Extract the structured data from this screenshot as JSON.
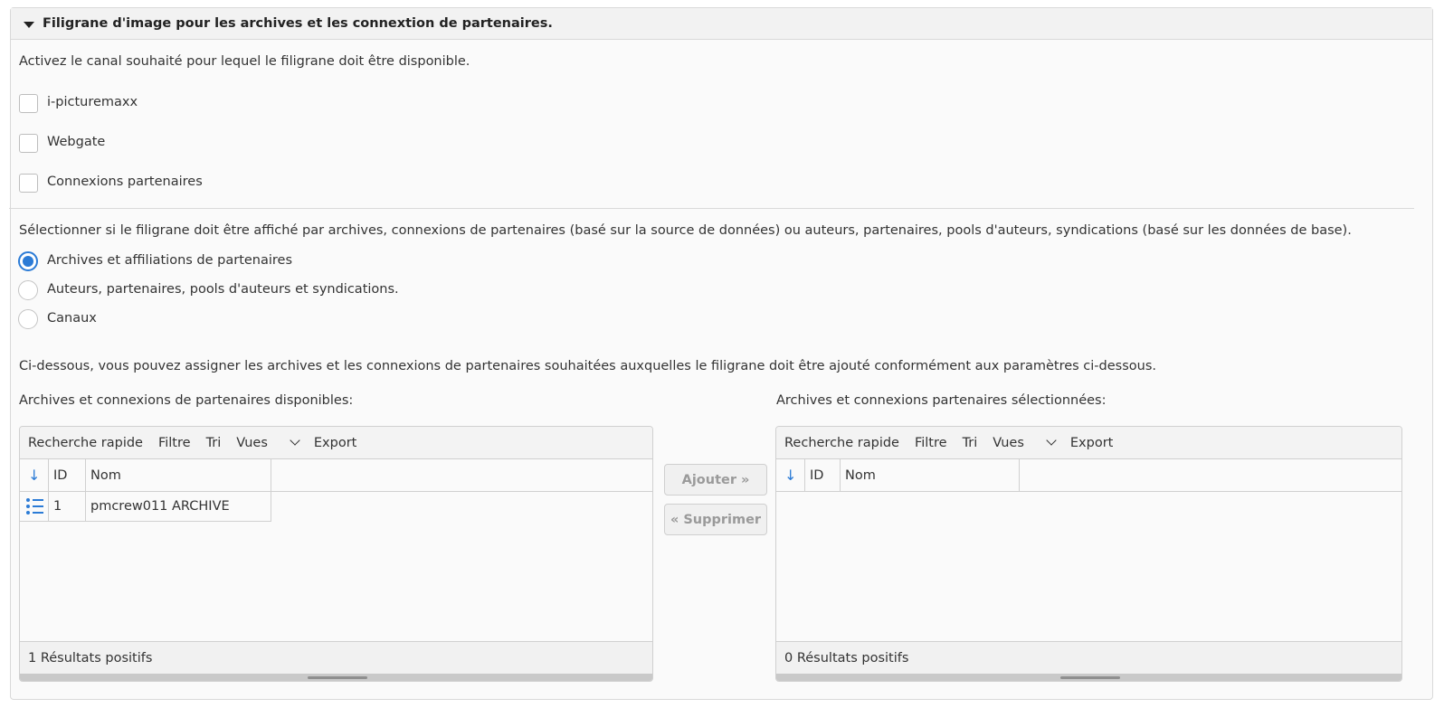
{
  "panel": {
    "title": "Filigrane d'image pour les archives et les connextion de partenaires."
  },
  "channels": {
    "intro": "Activez le canal souhaité pour lequel le filigrane doit être disponible.",
    "options": [
      {
        "label": "i-picturemaxx",
        "checked": false
      },
      {
        "label": "Webgate",
        "checked": false
      },
      {
        "label": "Connexions partenaires",
        "checked": false
      }
    ]
  },
  "display_mode": {
    "intro": "Sélectionner si le filigrane doit être affiché par archives, connexions de partenaires (basé sur la source de données) ou auteurs, partenaires, pools d'auteurs, syndications (basé sur les données de base).",
    "options": [
      {
        "label": "Archives et affiliations de partenaires",
        "selected": true
      },
      {
        "label": "Auteurs, partenaires, pools d'auteurs et syndications.",
        "selected": false
      },
      {
        "label": "Canaux",
        "selected": false
      }
    ]
  },
  "assign": {
    "intro": "Ci-dessous, vous pouvez assigner les archives et les connexions de partenaires souhaitées auxquelles le filigrane doit être ajouté conformément aux paramètres ci-dessous.",
    "available_label": "Archives et connexions de partenaires disponibles:",
    "selected_label": "Archives et connexions partenaires sélectionnées:",
    "add_button": "Ajouter",
    "remove_button": "Supprimer"
  },
  "toolbar": {
    "quick_search": "Recherche rapide",
    "filter": "Filtre",
    "sort": "Tri",
    "views": "Vues",
    "export": "Export"
  },
  "grid_columns": {
    "id": "ID",
    "name": "Nom"
  },
  "available_grid": {
    "rows": [
      {
        "id": "1",
        "name": "pmcrew011 ARCHIVE"
      }
    ],
    "footer": "1 Résultats positifs"
  },
  "selected_grid": {
    "rows": [],
    "footer": "0 Résultats positifs"
  },
  "colors": {
    "accent": "#2b7bd6",
    "border": "#d0d0d0"
  },
  "icons": [
    "caret-down-icon",
    "sort-down-icon",
    "chevron-down-icon",
    "row-detail-icon",
    "double-chevron-right-icon",
    "double-chevron-left-icon"
  ]
}
